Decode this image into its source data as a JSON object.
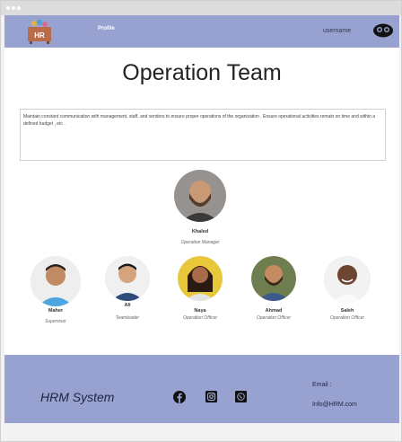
{
  "nav": {
    "logo_text": "HR",
    "profile_label": "Profile",
    "username": "username"
  },
  "page_title": "Operation Team",
  "description": "Maintain constant communication with management, staff, and vendors to ensure proper operations of the organization . Ensure operational activities remain on time and within a defined budget , etc .",
  "manager": {
    "name": "Khaled",
    "role": "Operation Manager"
  },
  "members": [
    {
      "name": "Maher",
      "role": "Supervisor"
    },
    {
      "name": "Ali",
      "role": "Teamleader"
    },
    {
      "name": "Naya",
      "role": "Operation Officer"
    },
    {
      "name": "Ahmad",
      "role": "Operation Officer"
    },
    {
      "name": "Saleh",
      "role": "Operation Officer"
    }
  ],
  "footer": {
    "brand": "HRM System",
    "email_label": "Email :",
    "email": "Info@HRM.com",
    "social_icons": [
      "facebook-icon",
      "instagram-icon",
      "whatsapp-icon"
    ]
  },
  "colors": {
    "nav_bg": "#98a2d1",
    "footer_bg": "#98a2d1"
  }
}
